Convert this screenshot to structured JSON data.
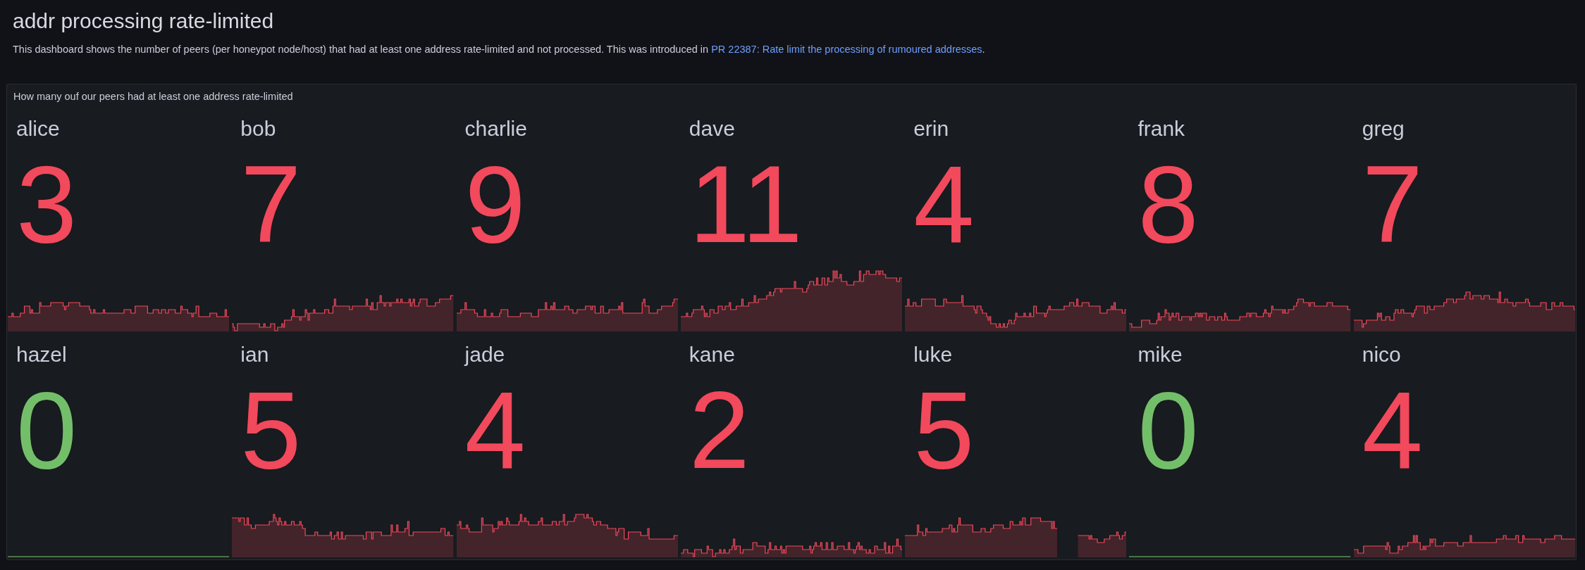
{
  "dashboard": {
    "title": "addr processing rate-limited",
    "description": {
      "text": "This dashboard shows the number of peers (per honeypot node/host) that had at least one address rate-limited and not processed. This was introduced in ",
      "link": "PR 22387: Rate limit the processing of rumoured addresses",
      "after": "."
    }
  },
  "panel": {
    "title": "How many ouf our peers had at least one address rate-limited",
    "tiles": [
      {
        "name": "alice",
        "value": "3",
        "color": "#f2495c"
      },
      {
        "name": "bob",
        "value": "7",
        "color": "#f2495c"
      },
      {
        "name": "charlie",
        "value": "9",
        "color": "#f2495c"
      },
      {
        "name": "dave",
        "value": "11",
        "color": "#f2495c"
      },
      {
        "name": "erin",
        "value": "4",
        "color": "#f2495c"
      },
      {
        "name": "frank",
        "value": "8",
        "color": "#f2495c"
      },
      {
        "name": "greg",
        "value": "7",
        "color": "#f2495c"
      },
      {
        "name": "hazel",
        "value": "0",
        "color": "#73bf69"
      },
      {
        "name": "ian",
        "value": "5",
        "color": "#f2495c"
      },
      {
        "name": "jade",
        "value": "4",
        "color": "#f2495c"
      },
      {
        "name": "kane",
        "value": "2",
        "color": "#f2495c"
      },
      {
        "name": "luke",
        "value": "5",
        "color": "#f2495c"
      },
      {
        "name": "mike",
        "value": "0",
        "color": "#73bf69"
      },
      {
        "name": "nico",
        "value": "4",
        "color": "#f2495c"
      }
    ]
  }
}
